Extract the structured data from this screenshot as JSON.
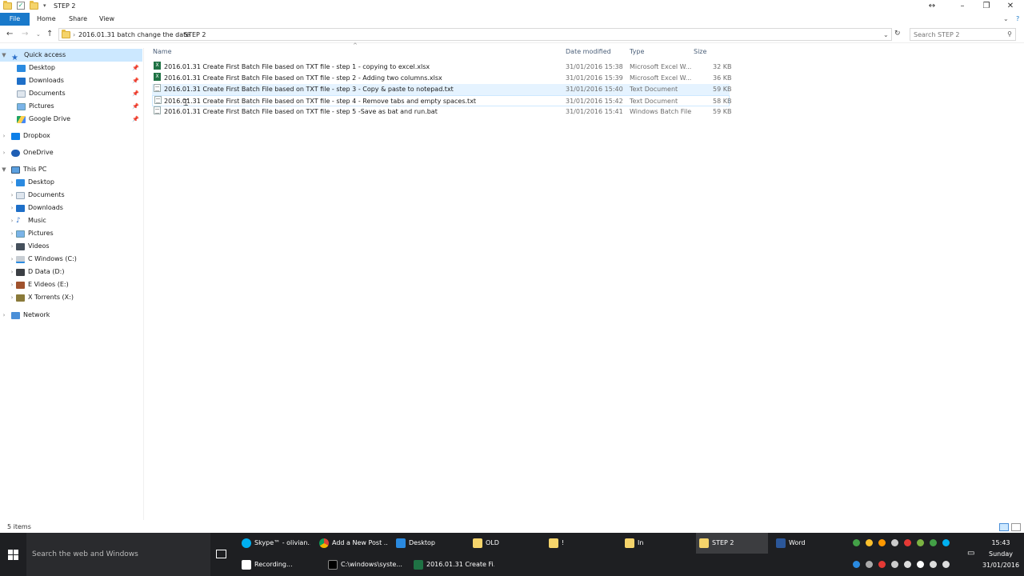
{
  "window": {
    "title": "STEP 2"
  },
  "ribbon": {
    "tabs": [
      "File",
      "Home",
      "Share",
      "View"
    ]
  },
  "address": {
    "crumbs": [
      "2016.01.31 batch change the date",
      "STEP 2"
    ],
    "search_placeholder": "Search STEP 2"
  },
  "nav": {
    "quick_access": "Quick access",
    "quick_items": [
      "Desktop",
      "Downloads",
      "Documents",
      "Pictures",
      "Google Drive"
    ],
    "dropbox": "Dropbox",
    "onedrive": "OneDrive",
    "this_pc": "This PC",
    "pc_items": [
      "Desktop",
      "Documents",
      "Downloads",
      "Music",
      "Pictures",
      "Videos",
      "C Windows (C:)",
      "D Data (D:)",
      "E Videos (E:)",
      "X Torrents (X:)"
    ],
    "network": "Network"
  },
  "columns": {
    "name": "Name",
    "date": "Date modified",
    "type": "Type",
    "size": "Size"
  },
  "files": [
    {
      "name": "2016.01.31 Create First Batch File based on TXT file - step 1 - copying to excel.xlsx",
      "date": "31/01/2016 15:38",
      "type": "Microsoft Excel W...",
      "size": "32 KB",
      "icon": "excel-icon"
    },
    {
      "name": "2016.01.31 Create First Batch File based on TXT file - step 2 - Adding two columns.xlsx",
      "date": "31/01/2016 15:39",
      "type": "Microsoft Excel W...",
      "size": "36 KB",
      "icon": "excel-icon"
    },
    {
      "name": "2016.01.31 Create First Batch File based on TXT file - step 3 - Copy & paste to notepad.txt",
      "date": "31/01/2016 15:40",
      "type": "Text Document",
      "size": "59 KB",
      "icon": "text-file-icon"
    },
    {
      "name": "2016.01.31 Create First Batch File based on TXT file - step 4 - Remove tabs and empty spaces.txt",
      "date": "31/01/2016 15:42",
      "type": "Text Document",
      "size": "58 KB",
      "icon": "text-file-icon"
    },
    {
      "name": "2016.01.31 Create First Batch File based on TXT file - step 5 -Save as bat and run.bat",
      "date": "31/01/2016 15:41",
      "type": "Windows Batch File",
      "size": "59 KB",
      "icon": "batch-file-icon"
    }
  ],
  "status": {
    "count": "5 items"
  },
  "taskbar": {
    "search": "Search the web and Windows",
    "row1": [
      "Skype™ - olivian...",
      "Add a New Post ...",
      "Desktop",
      "OLD",
      "!",
      "In",
      "STEP 2",
      "Word"
    ],
    "row2": [
      "Recording...",
      "C:\\windows\\syste...",
      "2016.01.31 Create Fi..."
    ],
    "time": "15:43",
    "day": "Sunday",
    "date": "31/01/2016"
  },
  "colors": {
    "accent": "#1979ca",
    "selection": "#cce8ff",
    "taskbar": "#1e1f22"
  }
}
